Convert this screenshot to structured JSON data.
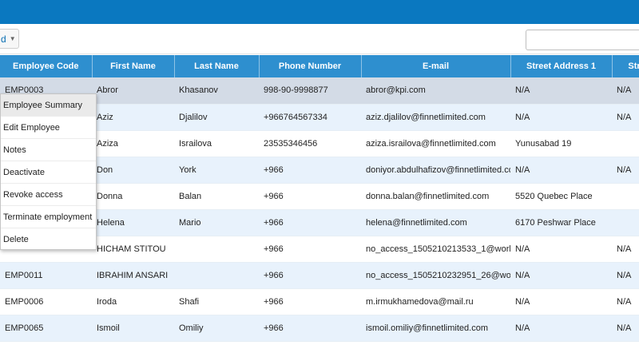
{
  "toolbar": {
    "dropdown_label": "d",
    "dropdown_icon": "chevron-down-icon",
    "search_value": ""
  },
  "table": {
    "headers": [
      "Employee Code",
      "First Name",
      "Last Name",
      "Phone Number",
      "E-mail",
      "Street Address 1",
      "Str"
    ],
    "rows": [
      [
        "EMP0003",
        "Abror",
        "Khasanov",
        "998-90-9998877",
        "abror@kpi.com",
        "N/A",
        "N/A"
      ],
      [
        "",
        "Aziz",
        "Djalilov",
        "+966764567334",
        "aziz.djalilov@finnetlimited.com",
        "N/A",
        "N/A"
      ],
      [
        "",
        "Aziza",
        "Israilova",
        "23535346456",
        "aziza.israilova@finnetlimited.com",
        "Yunusabad 19",
        ""
      ],
      [
        "",
        "Don",
        "York",
        "+966",
        "doniyor.abdulhafizov@finnetlimited.co",
        "N/A",
        "N/A"
      ],
      [
        "",
        "Donna",
        "Balan",
        "+966",
        "donna.balan@finnetlimited.com",
        "5520 Quebec Place",
        ""
      ],
      [
        "",
        "Helena",
        "Mario",
        "+966",
        "helena@finnetlimited.com",
        "6170 Peshwar Place",
        ""
      ],
      [
        "",
        "HICHAM STITOU",
        "",
        "+966",
        "no_access_1505210213533_1@work",
        "N/A",
        "N/A"
      ],
      [
        "EMP0011",
        "IBRAHIM ANSARI",
        "",
        "+966",
        "no_access_1505210232951_26@wor",
        "N/A",
        "N/A"
      ],
      [
        "EMP0006",
        "Iroda",
        "Shafi",
        "+966",
        "m.irmukhamedova@mail.ru",
        "N/A",
        "N/A"
      ],
      [
        "EMP0065",
        "Ismoil",
        "Omiliy",
        "+966",
        "ismoil.omiliy@finnetlimited.com",
        "N/A",
        "N/A"
      ]
    ]
  },
  "context_menu": {
    "items": [
      "Employee Summary",
      "Edit Employee",
      "Notes",
      "Deactivate",
      "Revoke access",
      "Terminate employment",
      "Delete"
    ],
    "hovered_index": 0
  },
  "colors": {
    "topbar": "#0a78c0",
    "header": "#2e8fcf",
    "row_alt": "#e8f2fc",
    "row_selected": "#d3dbe6"
  }
}
